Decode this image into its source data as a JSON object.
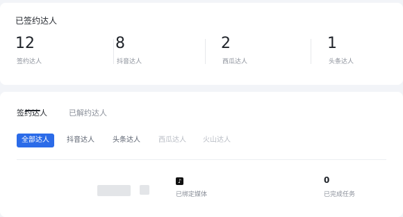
{
  "summary": {
    "title": "已签约达人",
    "stats": [
      {
        "value": "12",
        "label": "签约达人"
      },
      {
        "value": "8",
        "label": "抖音达人"
      },
      {
        "value": "2",
        "label": "西瓜达人"
      },
      {
        "value": "1",
        "label": "头条达人"
      }
    ]
  },
  "tabs": [
    {
      "label": "签约达人",
      "active": true
    },
    {
      "label": "已解约达人",
      "active": false
    }
  ],
  "filters": [
    {
      "label": "全部达人",
      "active": true
    },
    {
      "label": "抖音达人",
      "active": false
    },
    {
      "label": "头条达人",
      "active": false
    },
    {
      "label": "西瓜达人",
      "active": false
    },
    {
      "label": "火山达人",
      "active": false
    }
  ],
  "row": {
    "media_icon": "tiktok-icon",
    "media_label": "已绑定媒体",
    "tasks_value": "0",
    "tasks_label": "已完成任务"
  },
  "colors": {
    "accent": "#2b6be8",
    "background": "#f2f4f8",
    "card": "#ffffff"
  }
}
